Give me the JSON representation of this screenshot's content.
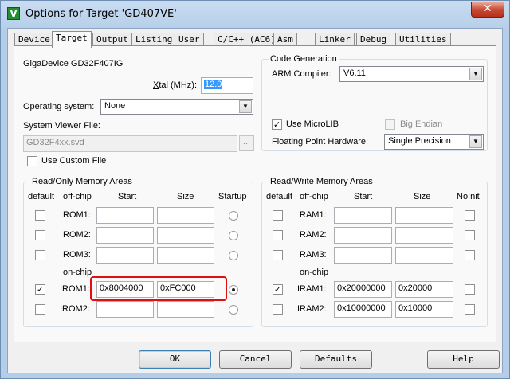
{
  "window": {
    "title": "Options for Target 'GD407VE'",
    "close_glyph": "✕",
    "app_icon_letter": "V"
  },
  "tabs": [
    "Device",
    "Target",
    "Output",
    "Listing",
    "User",
    "C/C++ (AC6)",
    "Asm",
    "Linker",
    "Debug",
    "Utilities"
  ],
  "active_tab": "Target",
  "target": {
    "device_name": "GigaDevice GD32F407IG",
    "xtal_label_prefix": "X",
    "xtal_label_rest": "tal (MHz):",
    "xtal_value": "12.0",
    "os_label": "Operating system:",
    "os_value": "None",
    "svf_label": "System Viewer File:",
    "svf_value": "GD32F4xx.svd",
    "browse_label": "...",
    "custom_file_label": "Use Custom File",
    "custom_file_checked": false
  },
  "code_generation": {
    "title": "Code Generation",
    "compiler_label": "ARM Compiler:",
    "compiler_value": "V6.11",
    "microlib_label": "Use MicroLIB",
    "microlib_checked": true,
    "bigendian_label": "Big Endian",
    "bigendian_checked": false,
    "fp_label": "Floating Point Hardware:",
    "fp_value": "Single Precision"
  },
  "ro_memory": {
    "title": "Read/Only Memory Areas",
    "headers": {
      "default": "default",
      "offchip": "off-chip",
      "start": "Start",
      "size": "Size",
      "startup": "Startup"
    },
    "onchip_label": "on-chip",
    "rows": [
      {
        "name": "ROM1:",
        "default": false,
        "start": "",
        "size": "",
        "startup": false
      },
      {
        "name": "ROM2:",
        "default": false,
        "start": "",
        "size": "",
        "startup": false
      },
      {
        "name": "ROM3:",
        "default": false,
        "start": "",
        "size": "",
        "startup": false
      },
      {
        "name": "IROM1:",
        "default": true,
        "start": "0x8004000",
        "size": "0xFC000",
        "startup": true
      },
      {
        "name": "IROM2:",
        "default": false,
        "start": "",
        "size": "",
        "startup": false
      }
    ]
  },
  "rw_memory": {
    "title": "Read/Write Memory Areas",
    "headers": {
      "default": "default",
      "offchip": "off-chip",
      "start": "Start",
      "size": "Size",
      "noinit": "NoInit"
    },
    "onchip_label": "on-chip",
    "rows": [
      {
        "name": "RAM1:",
        "default": false,
        "start": "",
        "size": "",
        "noinit": false
      },
      {
        "name": "RAM2:",
        "default": false,
        "start": "",
        "size": "",
        "noinit": false
      },
      {
        "name": "RAM3:",
        "default": false,
        "start": "",
        "size": "",
        "noinit": false
      },
      {
        "name": "IRAM1:",
        "default": true,
        "start": "0x20000000",
        "size": "0x20000",
        "noinit": false
      },
      {
        "name": "IRAM2:",
        "default": false,
        "start": "0x10000000",
        "size": "0x10000",
        "noinit": false
      }
    ]
  },
  "footer": {
    "ok": "OK",
    "cancel": "Cancel",
    "defaults": "Defaults",
    "help": "Help"
  },
  "colors": {
    "highlight": "#e01010",
    "selection": "#3399ff"
  }
}
